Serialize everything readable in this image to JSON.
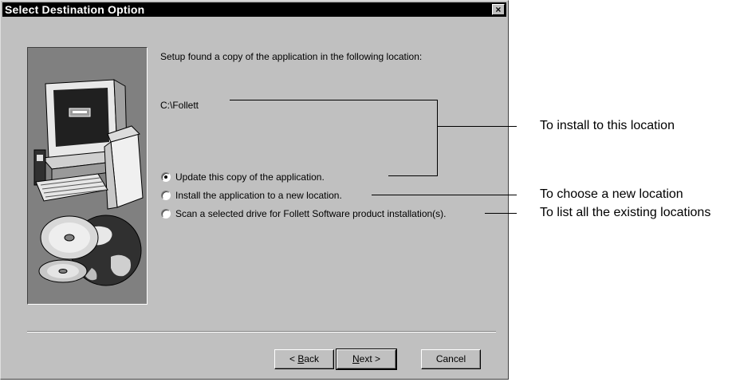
{
  "dialog": {
    "title": "Select Destination Option",
    "close_glyph": "×",
    "intro_text": "Setup found a copy of the application in the following location:",
    "location_path": "C:\\Follett",
    "options": [
      {
        "label": "Update this copy of the application.",
        "selected": true
      },
      {
        "label": "Install the application to a new location.",
        "selected": false
      },
      {
        "label": "Scan a selected drive for Follett Software product installation(s).",
        "selected": false
      }
    ],
    "buttons": {
      "back": {
        "prefix": "< ",
        "accel": "B",
        "rest": "ack"
      },
      "next": {
        "accel": "N",
        "rest": "ext >"
      },
      "cancel": "Cancel"
    }
  },
  "annotations": {
    "install_here": "To install to this location",
    "new_location": "To choose a new location",
    "list_locations": "To list all the existing locations"
  },
  "icons": [
    "computer-illustration",
    "cd-discs-illustration",
    "globe-illustration",
    "close-icon"
  ]
}
